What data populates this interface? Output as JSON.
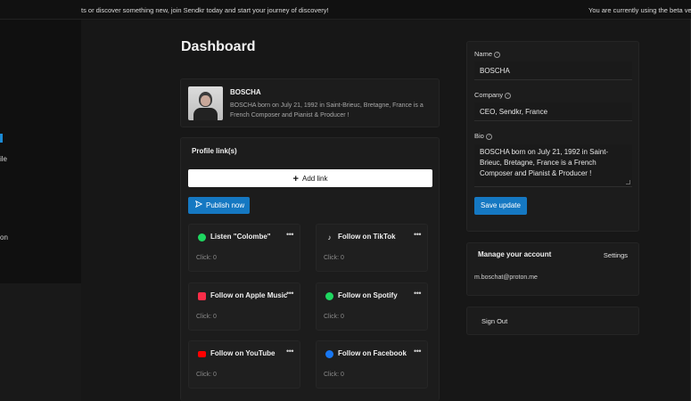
{
  "banner": {
    "marquee": "ts or discover something new, join Sendkr today and start your journey of discovery!",
    "beta_notice": "You are currently using the beta version"
  },
  "sidebar": {
    "items": [
      {
        "label": "l"
      },
      {
        "label": "ile"
      },
      {
        "label": "on"
      }
    ]
  },
  "dashboard": {
    "title": "Dashboard",
    "profile": {
      "name": "BOSCHA",
      "bio": "BOSCHA born on July 21, 1992 in Saint-Brieuc, Bretagne, France is a French Composer and Pianist & Producer !"
    },
    "links_section": {
      "title": "Profile link(s)",
      "add_label": "Add link",
      "publish_label": "Publish now",
      "more_icon": "•••",
      "links": [
        {
          "title": "Listen \"Colombe\"",
          "click": "Click: 0",
          "icon": "spotify-icon",
          "color": "#1ed760"
        },
        {
          "title": "Follow on TikTok",
          "click": "Click: 0",
          "icon": "tiktok-icon",
          "color": "#ffffff"
        },
        {
          "title": "Follow on Apple Music",
          "click": "Click: 0",
          "icon": "apple-music-icon",
          "color": "#fa2d48"
        },
        {
          "title": "Follow on Spotify",
          "click": "Click: 0",
          "icon": "spotify-icon",
          "color": "#1ed760"
        },
        {
          "title": "Follow on YouTube",
          "click": "Click: 0",
          "icon": "youtube-icon",
          "color": "#ff0000"
        },
        {
          "title": "Follow on Facebook",
          "click": "Click: 0",
          "icon": "facebook-icon",
          "color": "#1877f2"
        }
      ]
    }
  },
  "form": {
    "name_label": "Name",
    "name_value": "BOSCHA",
    "company_label": "Company",
    "company_value": "CEO, Sendkr, France",
    "bio_label": "Bio",
    "bio_value": "BOSCHA born on July 21, 1992 in Saint-Brieuc, Bretagne, France is a French Composer and Pianist & Producer !",
    "save_label": "Save update"
  },
  "account": {
    "title": "Manage your account",
    "settings_label": "Settings",
    "email": "m.boschat@proton.me"
  },
  "signout_label": "Sign Out",
  "colors": {
    "accent": "#1578c2",
    "background": "#161616",
    "card": "#1c1c1c"
  }
}
